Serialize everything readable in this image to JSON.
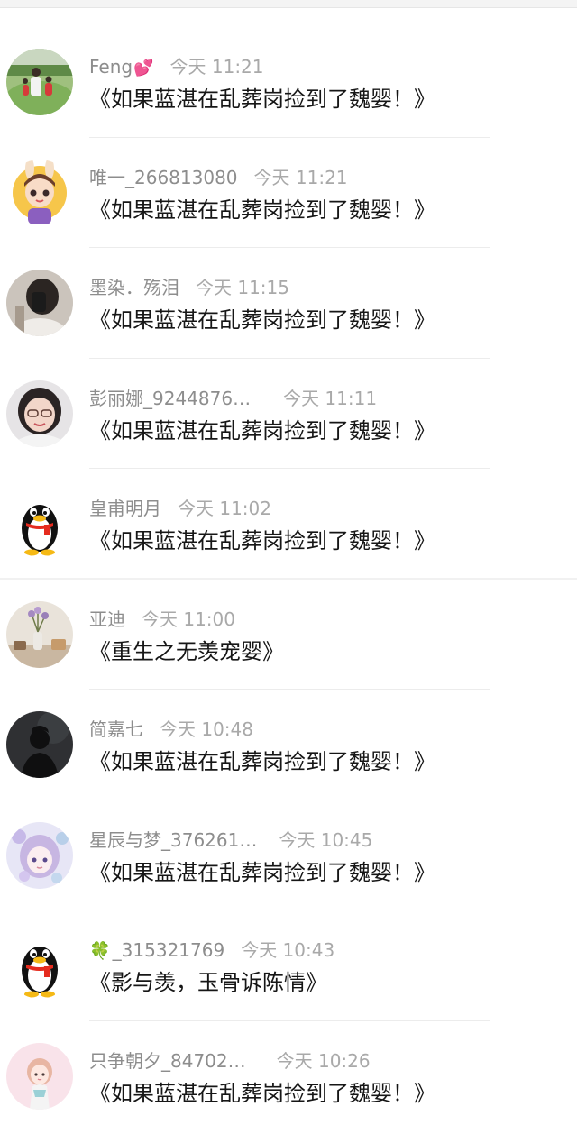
{
  "comments": [
    {
      "name": "Feng",
      "name_suffix": "💕",
      "time": "今天 11:21",
      "text": "《如果蓝湛在乱葬岗捡到了魏婴！》",
      "avatar": "photo-park-family-avatar"
    },
    {
      "name": "唯一_266813080",
      "time": "今天 11:21",
      "text": "《如果蓝湛在乱葬岗捡到了魏婴！》",
      "avatar": "cartoon-bunny-boy-avatar"
    },
    {
      "name": "墨染．殇泪",
      "time": "今天 11:15",
      "text": "《如果蓝湛在乱葬岗捡到了魏婴！》",
      "avatar": "photo-hidden-face-avatar"
    },
    {
      "name": "彭丽娜_9244876…",
      "time": "今天 11:11",
      "text": "《如果蓝湛在乱葬岗捡到了魏婴！》",
      "avatar": "photo-woman-glasses-avatar"
    },
    {
      "name": "皇甫明月",
      "time": "今天 11:02",
      "text": "《如果蓝湛在乱葬岗捡到了魏婴！》",
      "avatar": "qq-penguin-avatar"
    },
    {
      "name": "亚迪",
      "time": "今天 11:00",
      "text": "《重生之无羡宠婴》",
      "avatar": "photo-flower-vase-avatar"
    },
    {
      "name": "简嘉七",
      "time": "今天 10:48",
      "text": "《如果蓝湛在乱葬岗捡到了魏婴！》",
      "avatar": "dark-silhouette-avatar"
    },
    {
      "name": "星辰与梦_376261…",
      "time": "今天 10:45",
      "text": "《如果蓝湛在乱葬岗捡到了魏婴！》",
      "avatar": "anime-girl-purple-avatar"
    },
    {
      "name_prefix": "🍀",
      "name": "_315321769",
      "time": "今天 10:43",
      "text": "《影与羡，玉骨诉陈情》",
      "avatar": "qq-penguin-avatar"
    },
    {
      "name": "只争朝夕_84702…",
      "time": "今天 10:26",
      "text": "《如果蓝湛在乱葬岗捡到了魏婴！》",
      "avatar": "anime-girl-pink-avatar"
    }
  ]
}
